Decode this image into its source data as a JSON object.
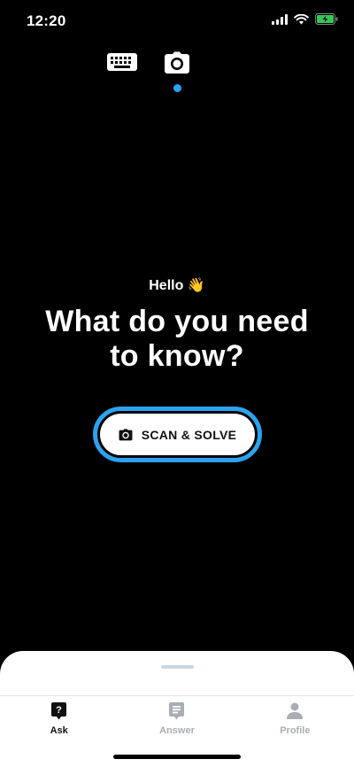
{
  "status_bar": {
    "time": "12:20"
  },
  "mode_switcher": {
    "modes": [
      "keyboard",
      "camera"
    ],
    "active": "camera",
    "dot_color": "#2aa3f0"
  },
  "hero": {
    "greeting": "Hello 👋",
    "headline": "What do you need to know?"
  },
  "scan_button": {
    "label": "SCAN & SOLVE",
    "ring_color": "#2aa3f0"
  },
  "tabs": [
    {
      "label": "Ask",
      "icon": "question-bubble-icon",
      "active": true,
      "color": "#111111"
    },
    {
      "label": "Answer",
      "icon": "document-icon",
      "active": false,
      "color": "#a9aeb5"
    },
    {
      "label": "Profile",
      "icon": "person-icon",
      "active": false,
      "color": "#a9aeb5"
    }
  ]
}
